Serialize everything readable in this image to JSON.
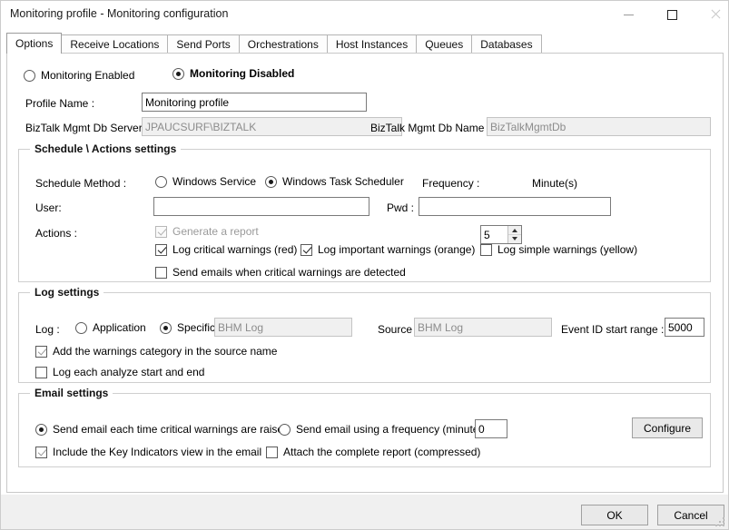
{
  "window": {
    "title": "Monitoring profile - Monitoring configuration",
    "controls": {
      "minimize": "minimize",
      "maximize": "maximize",
      "close": "close"
    }
  },
  "tabs": [
    {
      "label": "Options",
      "active": true
    },
    {
      "label": "Receive Locations",
      "active": false
    },
    {
      "label": "Send Ports",
      "active": false
    },
    {
      "label": "Orchestrations",
      "active": false
    },
    {
      "label": "Host Instances",
      "active": false
    },
    {
      "label": "Queues",
      "active": false
    },
    {
      "label": "Databases",
      "active": false
    }
  ],
  "status": {
    "enabled_label": "Monitoring Enabled",
    "enabled_selected": false,
    "enabled_color": "#14a028",
    "disabled_label": "Monitoring Disabled",
    "disabled_selected": true,
    "disabled_color": "#ef0000"
  },
  "profile": {
    "name_label": "Profile Name :",
    "name_value": "Monitoring profile",
    "db_server_label": "BizTalk Mgmt Db Server :",
    "db_server_value": "JPAUCSURF\\BIZTALK",
    "db_name_label": "BizTalk Mgmt Db Name :",
    "db_name_value": "BizTalkMgmtDb"
  },
  "schedule": {
    "group_title": "Schedule \\ Actions settings",
    "method_label": "Schedule Method :",
    "method_windows_service": "Windows Service",
    "method_windows_service_selected": false,
    "method_task_scheduler": "Windows Task Scheduler",
    "method_task_scheduler_selected": true,
    "frequency_label": "Frequency :",
    "frequency_value": "5",
    "frequency_unit": "Minute(s)",
    "user_label": "User:",
    "user_value": "",
    "pwd_label": "Pwd :",
    "pwd_value": "",
    "actions_label": "Actions :",
    "actions": [
      {
        "label": "Generate a report",
        "checked": true,
        "disabled": true
      },
      {
        "label": "Log critical warnings (red)",
        "checked": true,
        "disabled": false
      },
      {
        "label": "Log important warnings (orange)",
        "checked": true,
        "disabled": false
      },
      {
        "label": "Log simple warnings (yellow)",
        "checked": false,
        "disabled": false
      },
      {
        "label": "Send emails when critical warnings are detected",
        "checked": false,
        "disabled": false
      }
    ]
  },
  "log": {
    "group_title": "Log settings",
    "log_label": "Log :",
    "application_label": "Application",
    "application_selected": false,
    "specific_label": "Specific",
    "specific_selected": true,
    "specific_value": "BHM Log",
    "source_label": "Source :",
    "source_value": "BHM Log",
    "event_id_label": "Event ID start range :",
    "event_id_value": "5000",
    "add_category_label": "Add the warnings category in the source name",
    "add_category_checked": true,
    "log_each_label": "Log each analyze start and end",
    "log_each_checked": false
  },
  "email": {
    "group_title": "Email settings",
    "each_time_label": "Send email each time critical warnings are raised",
    "each_time_selected": true,
    "frequency_label": "Send email using a frequency (minutes) :",
    "frequency_selected": false,
    "frequency_value": "0",
    "include_key_indicators_label": "Include the Key Indicators view in the email",
    "include_key_indicators_checked": true,
    "attach_report_label": "Attach the complete report (compressed)",
    "attach_report_checked": false,
    "configure_label": "Configure"
  },
  "footer": {
    "ok_label": "OK",
    "cancel_label": "Cancel"
  }
}
